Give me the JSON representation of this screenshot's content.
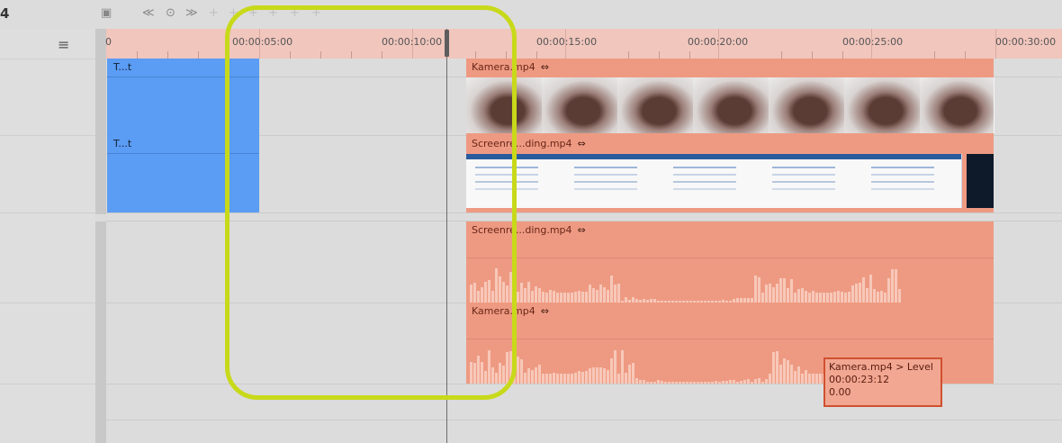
{
  "toolbar": {
    "frame_label": "4",
    "icons": [
      "image-icon",
      "rewind-icon",
      "record-icon",
      "fast-forward-icon",
      "keyframe-icon",
      "keyframe-icon",
      "keyframe-icon",
      "keyframe-icon",
      "keyframe-icon",
      "keyframe-icon"
    ]
  },
  "track_headers": {
    "menu_icon": "≡"
  },
  "ruler": {
    "labels": [
      "0",
      "00:00:05:00",
      "00:00:10:00",
      "00:00:15:00",
      "00:00:20:00",
      "00:00:25:00",
      "00:00:30:00"
    ]
  },
  "clips": {
    "text_clip_1": "T...t",
    "text_clip_2": "T...t",
    "video_camera": "Kamera.mp4",
    "video_screen": "Screenre...ding.mp4",
    "audio_screen": "Screenre...ding.mp4",
    "audio_camera": "Kamera.mp4",
    "link_icon": "⇔"
  },
  "tooltip": {
    "line1": "Kamera.mp4 > Level",
    "line2": "00:00:23:12",
    "line3": "0.00"
  },
  "colors": {
    "ruler": "#f1c6bd",
    "clip_blue": "#5b9cf4",
    "clip_orange": "#ee9a82",
    "highlight": "#c8d91a",
    "tooltip_border": "#d05030"
  }
}
